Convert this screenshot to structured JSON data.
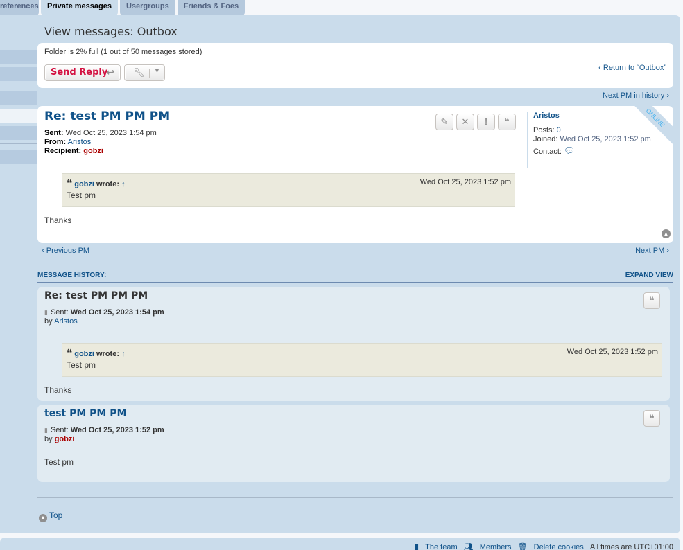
{
  "tabs": [
    "references",
    "Private messages",
    "Usergroups",
    "Friends & Foes"
  ],
  "page_title": "View messages: Outbox",
  "folder_status": "Folder is 2% full (1 out of 50 messages stored)",
  "send_reply_label": "Send Reply",
  "return_link": "Return to “Outbox”",
  "next_history": "Next PM in history",
  "post": {
    "title": "Re: test PM PM PM",
    "sent_label": "Sent:",
    "sent_value": "Wed Oct 25, 2023 1:54 pm",
    "from_label": "From:",
    "from_value": "Aristos",
    "recipient_label": "Recipient:",
    "recipient_value": "gobzi",
    "quote_author": "gobzi",
    "quote_wrote": "wrote:",
    "quote_arrow": "↑",
    "quote_date": "Wed Oct 25, 2023 1:52 pm",
    "quote_text": "Test pm",
    "body": "Thanks"
  },
  "profile": {
    "username": "Aristos",
    "posts_label": "Posts:",
    "posts_value": "0",
    "joined_label": "Joined:",
    "joined_value": "Wed Oct 25, 2023 1:52 pm",
    "contact_label": "Contact:",
    "online_label": "ONLINE"
  },
  "prev_pm": "Previous PM",
  "next_pm": "Next PM",
  "history_label": "MESSAGE HISTORY:",
  "expand_view": "EXPAND VIEW",
  "history": [
    {
      "title": "Re: test PM PM PM",
      "sent_label": "Sent:",
      "sent_value": "Wed Oct 25, 2023 1:54 pm",
      "by_label": "by",
      "author": "Aristos",
      "quote_author": "gobzi",
      "quote_wrote": "wrote:",
      "quote_arrow": "↑",
      "quote_date": "Wed Oct 25, 2023 1:52 pm",
      "quote_text": "Test pm",
      "body": "Thanks"
    },
    {
      "title": "test PM PM PM",
      "sent_label": "Sent:",
      "sent_value": "Wed Oct 25, 2023 1:52 pm",
      "by_label": "by",
      "author": "gobzi",
      "body": "Test pm"
    }
  ],
  "top_link": "Top",
  "footer": {
    "team": "The team",
    "members": "Members",
    "delete_cookies": "Delete cookies",
    "timezone": "All times are UTC+01:00"
  },
  "colors": {
    "link": "#105289",
    "panel_bg": "#cadceb",
    "red_user": "#aa0000",
    "send_reply": "#d31141",
    "online": "#48b3ef"
  }
}
